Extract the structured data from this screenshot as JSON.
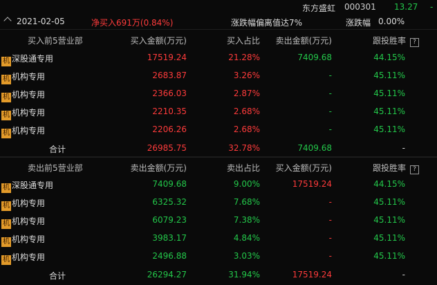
{
  "stock": {
    "name": "东方盛虹",
    "code": "000301",
    "price": "13.27",
    "change": "-"
  },
  "header": {
    "date": "2021-02-05",
    "net": "净买入691万(0.84%)",
    "reason": "涨跌幅偏离值达7%",
    "chg_label": "涨跌幅",
    "chg_value": "0.00%"
  },
  "buy": {
    "columns": [
      "买入前5营业部",
      "买入金额(万元)",
      "买入占比",
      "卖出金额(万元)",
      "跟投胜率"
    ],
    "rows": [
      {
        "badge": "机",
        "name": "深股通专用",
        "amt": "17519.24",
        "pct": "21.28%",
        "other": "7409.68",
        "win": "44.15%"
      },
      {
        "badge": "机",
        "name": "机构专用",
        "amt": "2683.87",
        "pct": "3.26%",
        "other": "-",
        "win": "45.11%"
      },
      {
        "badge": "机",
        "name": "机构专用",
        "amt": "2366.03",
        "pct": "2.87%",
        "other": "-",
        "win": "45.11%"
      },
      {
        "badge": "机",
        "name": "机构专用",
        "amt": "2210.35",
        "pct": "2.68%",
        "other": "-",
        "win": "45.11%"
      },
      {
        "badge": "机",
        "name": "机构专用",
        "amt": "2206.26",
        "pct": "2.68%",
        "other": "-",
        "win": "45.11%"
      }
    ],
    "total": {
      "label": "合计",
      "amt": "26985.75",
      "pct": "32.78%",
      "other": "7409.68",
      "win": "-"
    }
  },
  "sell": {
    "columns": [
      "卖出前5营业部",
      "卖出金额(万元)",
      "卖出占比",
      "买入金额(万元)",
      "跟投胜率"
    ],
    "rows": [
      {
        "badge": "机",
        "name": "深股通专用",
        "amt": "7409.68",
        "pct": "9.00%",
        "other": "17519.24",
        "win": "44.15%"
      },
      {
        "badge": "机",
        "name": "机构专用",
        "amt": "6325.32",
        "pct": "7.68%",
        "other": "-",
        "win": "45.11%"
      },
      {
        "badge": "机",
        "name": "机构专用",
        "amt": "6079.23",
        "pct": "7.38%",
        "other": "-",
        "win": "45.11%"
      },
      {
        "badge": "机",
        "name": "机构专用",
        "amt": "3983.17",
        "pct": "4.84%",
        "other": "-",
        "win": "45.11%"
      },
      {
        "badge": "机",
        "name": "机构专用",
        "amt": "2496.88",
        "pct": "3.03%",
        "other": "-",
        "win": "45.11%"
      }
    ],
    "total": {
      "label": "合计",
      "amt": "26294.27",
      "pct": "31.94%",
      "other": "17519.24",
      "win": "-"
    }
  }
}
